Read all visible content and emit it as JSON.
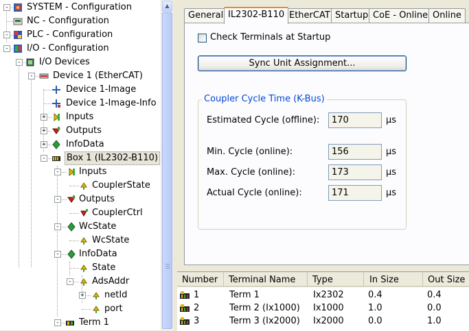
{
  "tree": {
    "nodes": [
      {
        "label": "SYSTEM - Configuration",
        "icon": "system-config-icon"
      },
      {
        "label": "NC - Configuration",
        "icon": "nc-config-icon"
      },
      {
        "label": "PLC - Configuration",
        "icon": "plc-config-icon"
      },
      {
        "label": "I/O - Configuration",
        "icon": "io-config-icon"
      },
      {
        "label": "I/O Devices",
        "icon": "io-devices-icon"
      },
      {
        "label": "Device 1 (EtherCAT)",
        "icon": "ethercat-device-icon"
      },
      {
        "label": "Device 1-Image",
        "icon": "image-icon"
      },
      {
        "label": "Device 1-Image-Info",
        "icon": "image-info-icon"
      },
      {
        "label": "Inputs",
        "icon": "inputs-icon"
      },
      {
        "label": "Outputs",
        "icon": "outputs-icon"
      },
      {
        "label": "InfoData",
        "icon": "infodata-icon"
      },
      {
        "label": "Box 1 (IL2302-B110)",
        "icon": "box-icon"
      },
      {
        "label": "Inputs",
        "icon": "inputs-icon"
      },
      {
        "label": "CouplerState",
        "icon": "input-variable-icon"
      },
      {
        "label": "Outputs",
        "icon": "outputs-icon"
      },
      {
        "label": "CouplerCtrl",
        "icon": "output-variable-icon"
      },
      {
        "label": "WcState",
        "icon": "wcstate-icon"
      },
      {
        "label": "WcState",
        "icon": "input-variable-icon"
      },
      {
        "label": "InfoData",
        "icon": "infodata-icon"
      },
      {
        "label": "State",
        "icon": "input-variable-icon"
      },
      {
        "label": "AdsAddr",
        "icon": "input-variable-icon"
      },
      {
        "label": "netId",
        "icon": "input-variable-icon"
      },
      {
        "label": "port",
        "icon": "input-variable-icon"
      },
      {
        "label": "Term 1",
        "icon": "terminal-icon"
      }
    ]
  },
  "tabs": [
    {
      "label": "General"
    },
    {
      "label": "IL2302-B110"
    },
    {
      "label": "EtherCAT"
    },
    {
      "label": "Startup"
    },
    {
      "label": "CoE - Online"
    },
    {
      "label": "Online"
    }
  ],
  "active_tab": "IL2302-B110",
  "panel": {
    "check_terminals_label": "Check Terminals at Startup",
    "check_terminals_checked": false,
    "sync_button_label": "Sync Unit Assignment...",
    "group_title": "Coupler Cycle Time (K-Bus)",
    "fields": [
      {
        "label": "Estimated Cycle (offline):",
        "value": "170",
        "unit": "µs"
      },
      {
        "label": "Min. Cycle (online):",
        "value": "156",
        "unit": "µs"
      },
      {
        "label": "Max. Cycle (online):",
        "value": "173",
        "unit": "µs"
      },
      {
        "label": "Actual Cycle (online):",
        "value": "171",
        "unit": "µs"
      }
    ]
  },
  "list": {
    "columns": [
      "Number",
      "Terminal Name",
      "Type",
      "In Size",
      "Out Size"
    ],
    "rows": [
      {
        "number": "1",
        "name": "Term 1",
        "type": "Ix2302",
        "in": "0.4",
        "out": "0.4"
      },
      {
        "number": "2",
        "name": "Term 2 (Ix1000)",
        "type": "Ix1000",
        "in": "1.0",
        "out": "0.0"
      },
      {
        "number": "3",
        "name": "Term 3 (Ix2000)",
        "type": "Ix2000",
        "in": "0.0",
        "out": "1.0"
      }
    ]
  },
  "colors": {
    "selection_frame": "#888888",
    "active_tab_accent": "#e68b2c",
    "group_title": "#0046d5",
    "field_border": "#7f9db9"
  }
}
